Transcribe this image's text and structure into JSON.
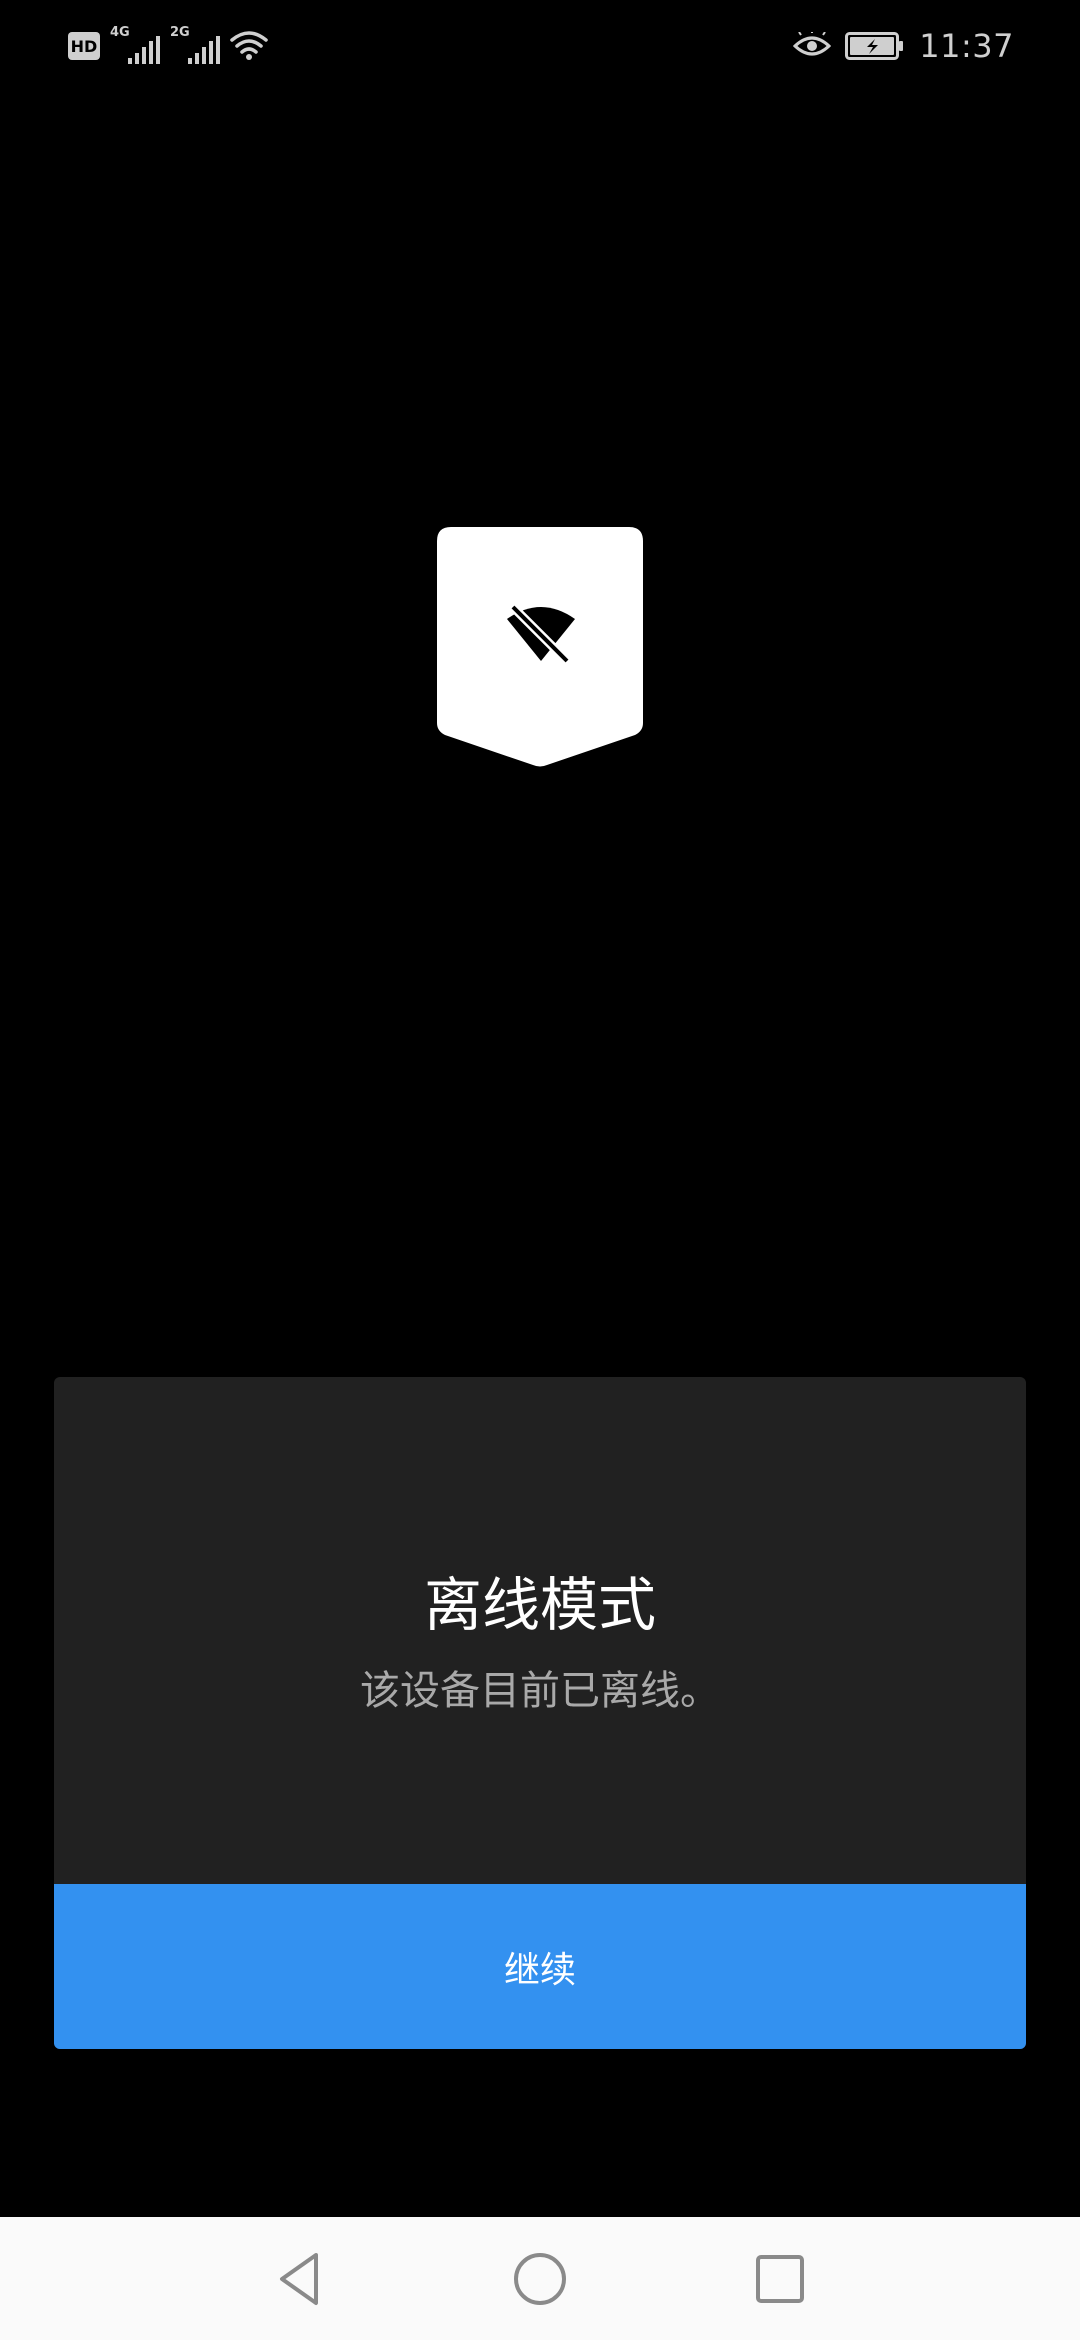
{
  "status_bar": {
    "hd_label": "HD",
    "network1_label": "4G",
    "network2_label": "2G",
    "wifi_icon": "wifi-icon",
    "eye_icon": "eye-comfort-icon",
    "battery_icon": "battery-charging-icon",
    "time": "11:37"
  },
  "logo": {
    "icon": "wifi-off-icon",
    "background_color": "#ffffff"
  },
  "dialog": {
    "title": "离线模式",
    "message": "该设备目前已离线。",
    "continue_label": "继续",
    "button_color": "#3391f0",
    "card_color": "#212121"
  },
  "nav_bar": {
    "back_icon": "back-triangle-icon",
    "home_icon": "home-circle-icon",
    "recents_icon": "recents-square-icon"
  }
}
